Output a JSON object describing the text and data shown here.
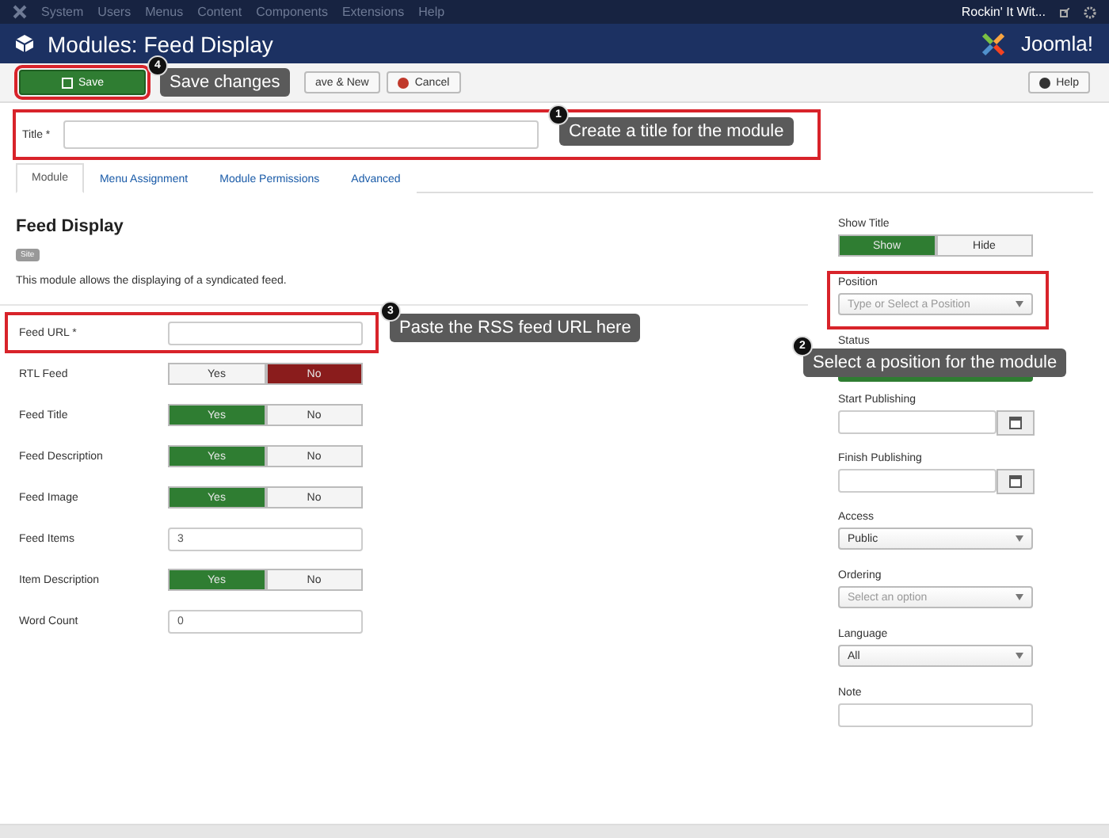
{
  "top_menu": {
    "items": [
      "System",
      "Users",
      "Menus",
      "Content",
      "Components",
      "Extensions",
      "Help"
    ],
    "site": "Rockin' It Wit..."
  },
  "header": {
    "title": "Modules: Feed Display",
    "logo": "Joomla!"
  },
  "toolbar": {
    "buttons": [
      {
        "label": "Save",
        "kind": "primary",
        "highlighted": true
      },
      {
        "label": "ave & New",
        "kind": "plain"
      },
      {
        "label": "Cancel",
        "kind": "cancel"
      }
    ],
    "help": "Help"
  },
  "title_field": {
    "label": "Title *",
    "highlighted": true
  },
  "tabs": [
    {
      "label": "Module",
      "selected": true
    },
    {
      "label": "Menu Assignment",
      "selected": false
    },
    {
      "label": "Module Permissions",
      "selected": false
    },
    {
      "label": "Advanced",
      "selected": false
    }
  ],
  "module": {
    "name": "Feed Display",
    "badge": "Site",
    "description": "This module allows the displaying of a syndicated feed."
  },
  "fields": [
    {
      "label": "Feed URL *",
      "kind": "text",
      "highlighted": true
    },
    {
      "label": "RTL Feed",
      "kind": "toggle",
      "options": [
        {
          "label": "Yes",
          "selected": false
        },
        {
          "label": "No",
          "selected": true
        }
      ]
    },
    {
      "label": "Feed Title",
      "kind": "toggle",
      "options": [
        {
          "label": "Yes",
          "selected": true
        },
        {
          "label": "No",
          "selected": false
        }
      ]
    },
    {
      "label": "Feed Description",
      "kind": "toggle",
      "options": [
        {
          "label": "Yes",
          "selected": true
        },
        {
          "label": "No",
          "selected": false
        }
      ]
    },
    {
      "label": "Feed Image",
      "kind": "toggle",
      "options": [
        {
          "label": "Yes",
          "selected": true
        },
        {
          "label": "No",
          "selected": false
        }
      ]
    },
    {
      "label": "Feed Items",
      "kind": "text",
      "value": "3"
    },
    {
      "label": "Item Description",
      "kind": "toggle",
      "options": [
        {
          "label": "Yes",
          "selected": true
        },
        {
          "label": "No",
          "selected": false
        }
      ]
    },
    {
      "label": "Word Count",
      "kind": "text",
      "value": "0"
    }
  ],
  "sidebar": [
    {
      "label": "Show Title",
      "kind": "toggle",
      "options": [
        {
          "label": "Show",
          "selected": true
        },
        {
          "label": "Hide",
          "selected": false
        }
      ]
    },
    {
      "label": "Position",
      "kind": "select",
      "highlighted": true,
      "placeholder": "Type or Select a Position"
    },
    {
      "label": "Status",
      "kind": "status"
    },
    {
      "label": "Start Publishing",
      "kind": "date"
    },
    {
      "label": "Finish Publishing",
      "kind": "date"
    },
    {
      "label": "Access",
      "kind": "select",
      "value": "Public"
    },
    {
      "label": "Ordering",
      "kind": "select",
      "placeholder": "Select an option"
    },
    {
      "label": "Language",
      "kind": "select",
      "value": "All"
    },
    {
      "label": "Note",
      "kind": "text"
    }
  ],
  "callouts": [
    {
      "number": "1",
      "text": "Create a title for the module"
    },
    {
      "number": "2",
      "text": "Select a position for the module"
    },
    {
      "number": "3",
      "text": "Paste the RSS feed URL here"
    },
    {
      "number": "4",
      "text": "Save changes"
    }
  ]
}
